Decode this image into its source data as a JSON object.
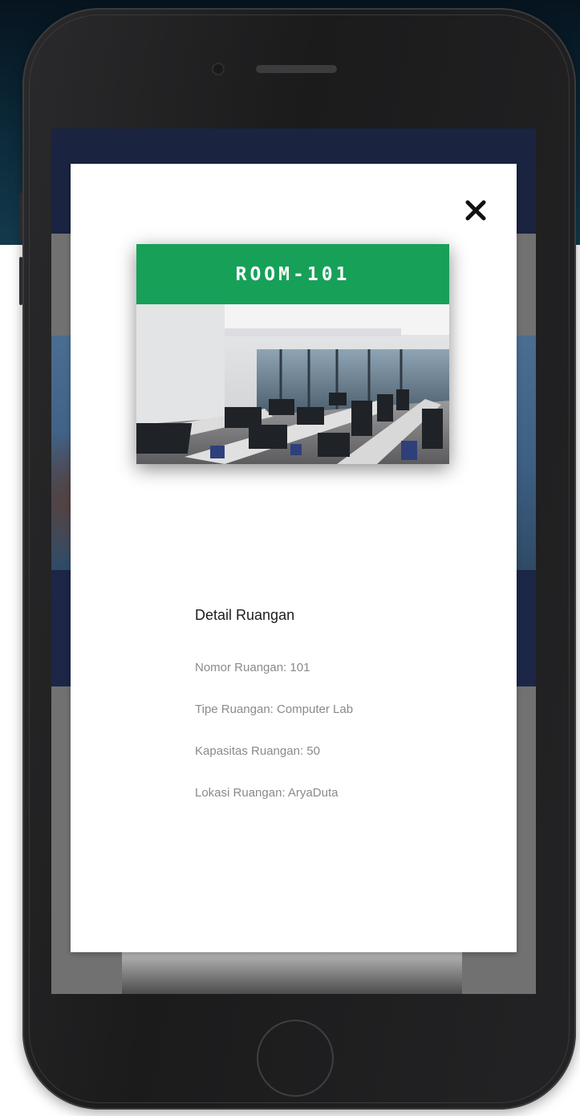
{
  "modal": {
    "close_icon": "close-icon",
    "room_card": {
      "title": "ROOM-101",
      "header_color": "#17a058"
    },
    "details": {
      "heading": "Detail Ruangan",
      "items": [
        "Nomor Ruangan: 101",
        "Tipe Ruangan: Computer Lab",
        "Kapasitas Ruangan: 50",
        "Lokasi Ruangan: AryaDuta"
      ]
    }
  },
  "colors": {
    "app_header": "#1a2340",
    "overlay": "#717171",
    "page_banner": "#0c2a3a"
  }
}
